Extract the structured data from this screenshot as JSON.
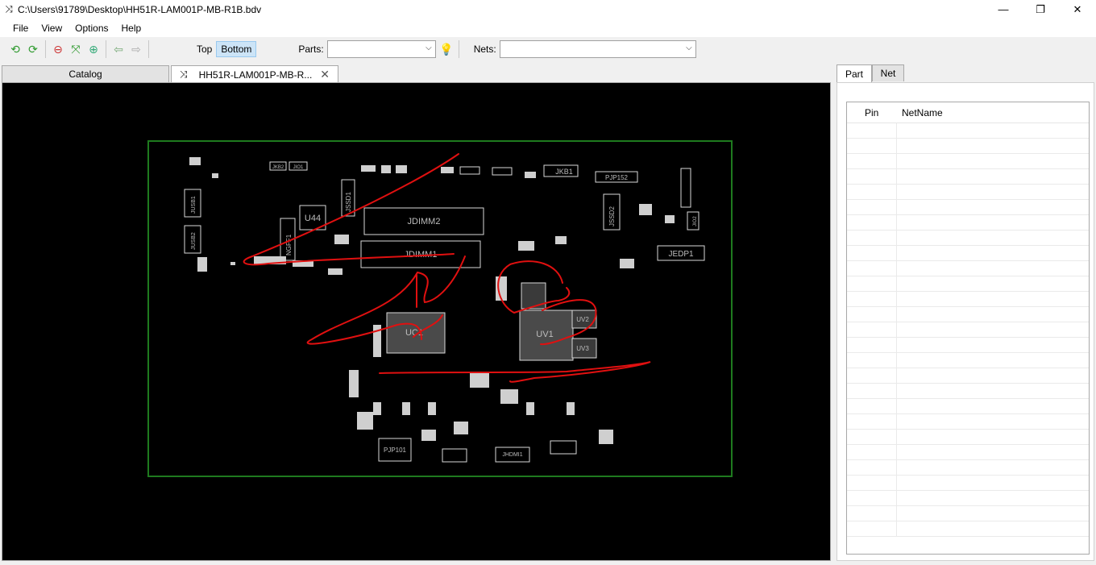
{
  "window": {
    "title": "C:\\Users\\91789\\Desktop\\HH51R-LAM001P-MB-R1B.bdv",
    "minimize": "—",
    "maximize": "❐",
    "close": "✕"
  },
  "menu": [
    "File",
    "View",
    "Options",
    "Help"
  ],
  "toolbar": {
    "top_label": "Top",
    "bottom_label": "Bottom",
    "parts_label": "Parts:",
    "parts_value": "",
    "nets_label": "Nets:",
    "nets_value": "",
    "icons": [
      "rotate-left-icon",
      "rotate-right-icon",
      "zoom-out-icon",
      "fit-icon",
      "zoom-in-icon",
      "back-arrow-icon",
      "forward-arrow-icon",
      "bulb-icon"
    ]
  },
  "tabs": {
    "catalog": "Catalog",
    "file": "HH51R-LAM001P-MB-R..."
  },
  "right_tabs": [
    "Part",
    "Net"
  ],
  "grid": {
    "columns": [
      "Pin",
      "NetName"
    ],
    "empty_rows": 27
  },
  "board": {
    "labels": {
      "jdimm2": "JDIMM2",
      "jdimm1": "JDIMM1",
      "u44": "U44",
      "jssd1": "JSSD1",
      "jssd2": "JSSD2",
      "jkb1": "JKB1",
      "pjp152": "PJP152",
      "jedp1": "JEDP1",
      "uv1": "UV1",
      "uc1": "UC1",
      "pjp101": "PJP101",
      "jhdmi1": "JHDMI1",
      "jusb1": "JUSB1",
      "jusb2": "JUSB2",
      "ngff1": "NGFF1",
      "jio2": "JIO2",
      "jkb2": "JKB2",
      "jio1": "JIO1",
      "uv2": "UV2",
      "uv3": "UV3"
    }
  },
  "colors": {
    "board_outline": "#1e7a1e",
    "annotation": "#e01010",
    "component": "#d8d8d8",
    "canvas_bg": "#000000"
  }
}
